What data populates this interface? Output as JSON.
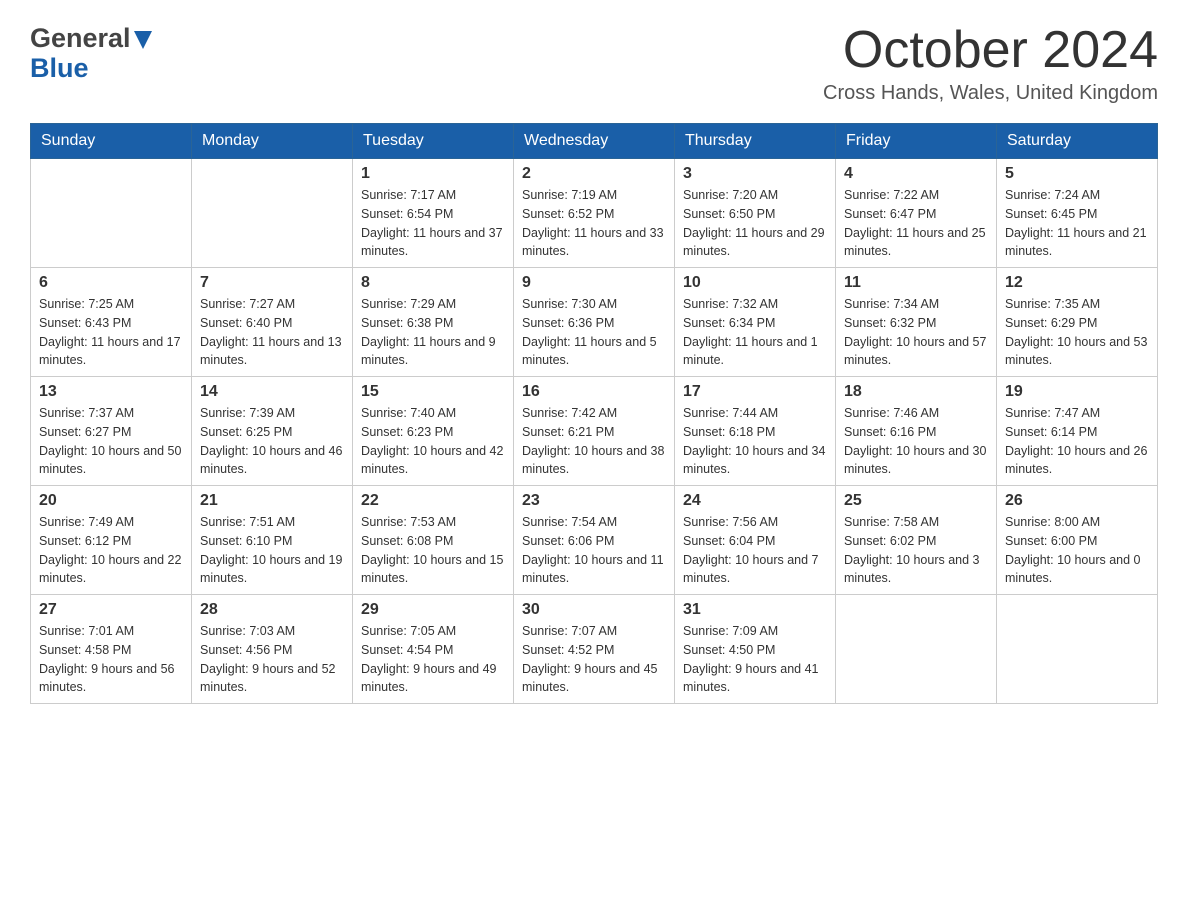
{
  "header": {
    "logo_general": "General",
    "logo_blue": "Blue",
    "month_title": "October 2024",
    "location": "Cross Hands, Wales, United Kingdom"
  },
  "days_of_week": [
    "Sunday",
    "Monday",
    "Tuesday",
    "Wednesday",
    "Thursday",
    "Friday",
    "Saturday"
  ],
  "weeks": [
    [
      {
        "day": "",
        "sunrise": "",
        "sunset": "",
        "daylight": ""
      },
      {
        "day": "",
        "sunrise": "",
        "sunset": "",
        "daylight": ""
      },
      {
        "day": "1",
        "sunrise": "Sunrise: 7:17 AM",
        "sunset": "Sunset: 6:54 PM",
        "daylight": "Daylight: 11 hours and 37 minutes."
      },
      {
        "day": "2",
        "sunrise": "Sunrise: 7:19 AM",
        "sunset": "Sunset: 6:52 PM",
        "daylight": "Daylight: 11 hours and 33 minutes."
      },
      {
        "day": "3",
        "sunrise": "Sunrise: 7:20 AM",
        "sunset": "Sunset: 6:50 PM",
        "daylight": "Daylight: 11 hours and 29 minutes."
      },
      {
        "day": "4",
        "sunrise": "Sunrise: 7:22 AM",
        "sunset": "Sunset: 6:47 PM",
        "daylight": "Daylight: 11 hours and 25 minutes."
      },
      {
        "day": "5",
        "sunrise": "Sunrise: 7:24 AM",
        "sunset": "Sunset: 6:45 PM",
        "daylight": "Daylight: 11 hours and 21 minutes."
      }
    ],
    [
      {
        "day": "6",
        "sunrise": "Sunrise: 7:25 AM",
        "sunset": "Sunset: 6:43 PM",
        "daylight": "Daylight: 11 hours and 17 minutes."
      },
      {
        "day": "7",
        "sunrise": "Sunrise: 7:27 AM",
        "sunset": "Sunset: 6:40 PM",
        "daylight": "Daylight: 11 hours and 13 minutes."
      },
      {
        "day": "8",
        "sunrise": "Sunrise: 7:29 AM",
        "sunset": "Sunset: 6:38 PM",
        "daylight": "Daylight: 11 hours and 9 minutes."
      },
      {
        "day": "9",
        "sunrise": "Sunrise: 7:30 AM",
        "sunset": "Sunset: 6:36 PM",
        "daylight": "Daylight: 11 hours and 5 minutes."
      },
      {
        "day": "10",
        "sunrise": "Sunrise: 7:32 AM",
        "sunset": "Sunset: 6:34 PM",
        "daylight": "Daylight: 11 hours and 1 minute."
      },
      {
        "day": "11",
        "sunrise": "Sunrise: 7:34 AM",
        "sunset": "Sunset: 6:32 PM",
        "daylight": "Daylight: 10 hours and 57 minutes."
      },
      {
        "day": "12",
        "sunrise": "Sunrise: 7:35 AM",
        "sunset": "Sunset: 6:29 PM",
        "daylight": "Daylight: 10 hours and 53 minutes."
      }
    ],
    [
      {
        "day": "13",
        "sunrise": "Sunrise: 7:37 AM",
        "sunset": "Sunset: 6:27 PM",
        "daylight": "Daylight: 10 hours and 50 minutes."
      },
      {
        "day": "14",
        "sunrise": "Sunrise: 7:39 AM",
        "sunset": "Sunset: 6:25 PM",
        "daylight": "Daylight: 10 hours and 46 minutes."
      },
      {
        "day": "15",
        "sunrise": "Sunrise: 7:40 AM",
        "sunset": "Sunset: 6:23 PM",
        "daylight": "Daylight: 10 hours and 42 minutes."
      },
      {
        "day": "16",
        "sunrise": "Sunrise: 7:42 AM",
        "sunset": "Sunset: 6:21 PM",
        "daylight": "Daylight: 10 hours and 38 minutes."
      },
      {
        "day": "17",
        "sunrise": "Sunrise: 7:44 AM",
        "sunset": "Sunset: 6:18 PM",
        "daylight": "Daylight: 10 hours and 34 minutes."
      },
      {
        "day": "18",
        "sunrise": "Sunrise: 7:46 AM",
        "sunset": "Sunset: 6:16 PM",
        "daylight": "Daylight: 10 hours and 30 minutes."
      },
      {
        "day": "19",
        "sunrise": "Sunrise: 7:47 AM",
        "sunset": "Sunset: 6:14 PM",
        "daylight": "Daylight: 10 hours and 26 minutes."
      }
    ],
    [
      {
        "day": "20",
        "sunrise": "Sunrise: 7:49 AM",
        "sunset": "Sunset: 6:12 PM",
        "daylight": "Daylight: 10 hours and 22 minutes."
      },
      {
        "day": "21",
        "sunrise": "Sunrise: 7:51 AM",
        "sunset": "Sunset: 6:10 PM",
        "daylight": "Daylight: 10 hours and 19 minutes."
      },
      {
        "day": "22",
        "sunrise": "Sunrise: 7:53 AM",
        "sunset": "Sunset: 6:08 PM",
        "daylight": "Daylight: 10 hours and 15 minutes."
      },
      {
        "day": "23",
        "sunrise": "Sunrise: 7:54 AM",
        "sunset": "Sunset: 6:06 PM",
        "daylight": "Daylight: 10 hours and 11 minutes."
      },
      {
        "day": "24",
        "sunrise": "Sunrise: 7:56 AM",
        "sunset": "Sunset: 6:04 PM",
        "daylight": "Daylight: 10 hours and 7 minutes."
      },
      {
        "day": "25",
        "sunrise": "Sunrise: 7:58 AM",
        "sunset": "Sunset: 6:02 PM",
        "daylight": "Daylight: 10 hours and 3 minutes."
      },
      {
        "day": "26",
        "sunrise": "Sunrise: 8:00 AM",
        "sunset": "Sunset: 6:00 PM",
        "daylight": "Daylight: 10 hours and 0 minutes."
      }
    ],
    [
      {
        "day": "27",
        "sunrise": "Sunrise: 7:01 AM",
        "sunset": "Sunset: 4:58 PM",
        "daylight": "Daylight: 9 hours and 56 minutes."
      },
      {
        "day": "28",
        "sunrise": "Sunrise: 7:03 AM",
        "sunset": "Sunset: 4:56 PM",
        "daylight": "Daylight: 9 hours and 52 minutes."
      },
      {
        "day": "29",
        "sunrise": "Sunrise: 7:05 AM",
        "sunset": "Sunset: 4:54 PM",
        "daylight": "Daylight: 9 hours and 49 minutes."
      },
      {
        "day": "30",
        "sunrise": "Sunrise: 7:07 AM",
        "sunset": "Sunset: 4:52 PM",
        "daylight": "Daylight: 9 hours and 45 minutes."
      },
      {
        "day": "31",
        "sunrise": "Sunrise: 7:09 AM",
        "sunset": "Sunset: 4:50 PM",
        "daylight": "Daylight: 9 hours and 41 minutes."
      },
      {
        "day": "",
        "sunrise": "",
        "sunset": "",
        "daylight": ""
      },
      {
        "day": "",
        "sunrise": "",
        "sunset": "",
        "daylight": ""
      }
    ]
  ]
}
